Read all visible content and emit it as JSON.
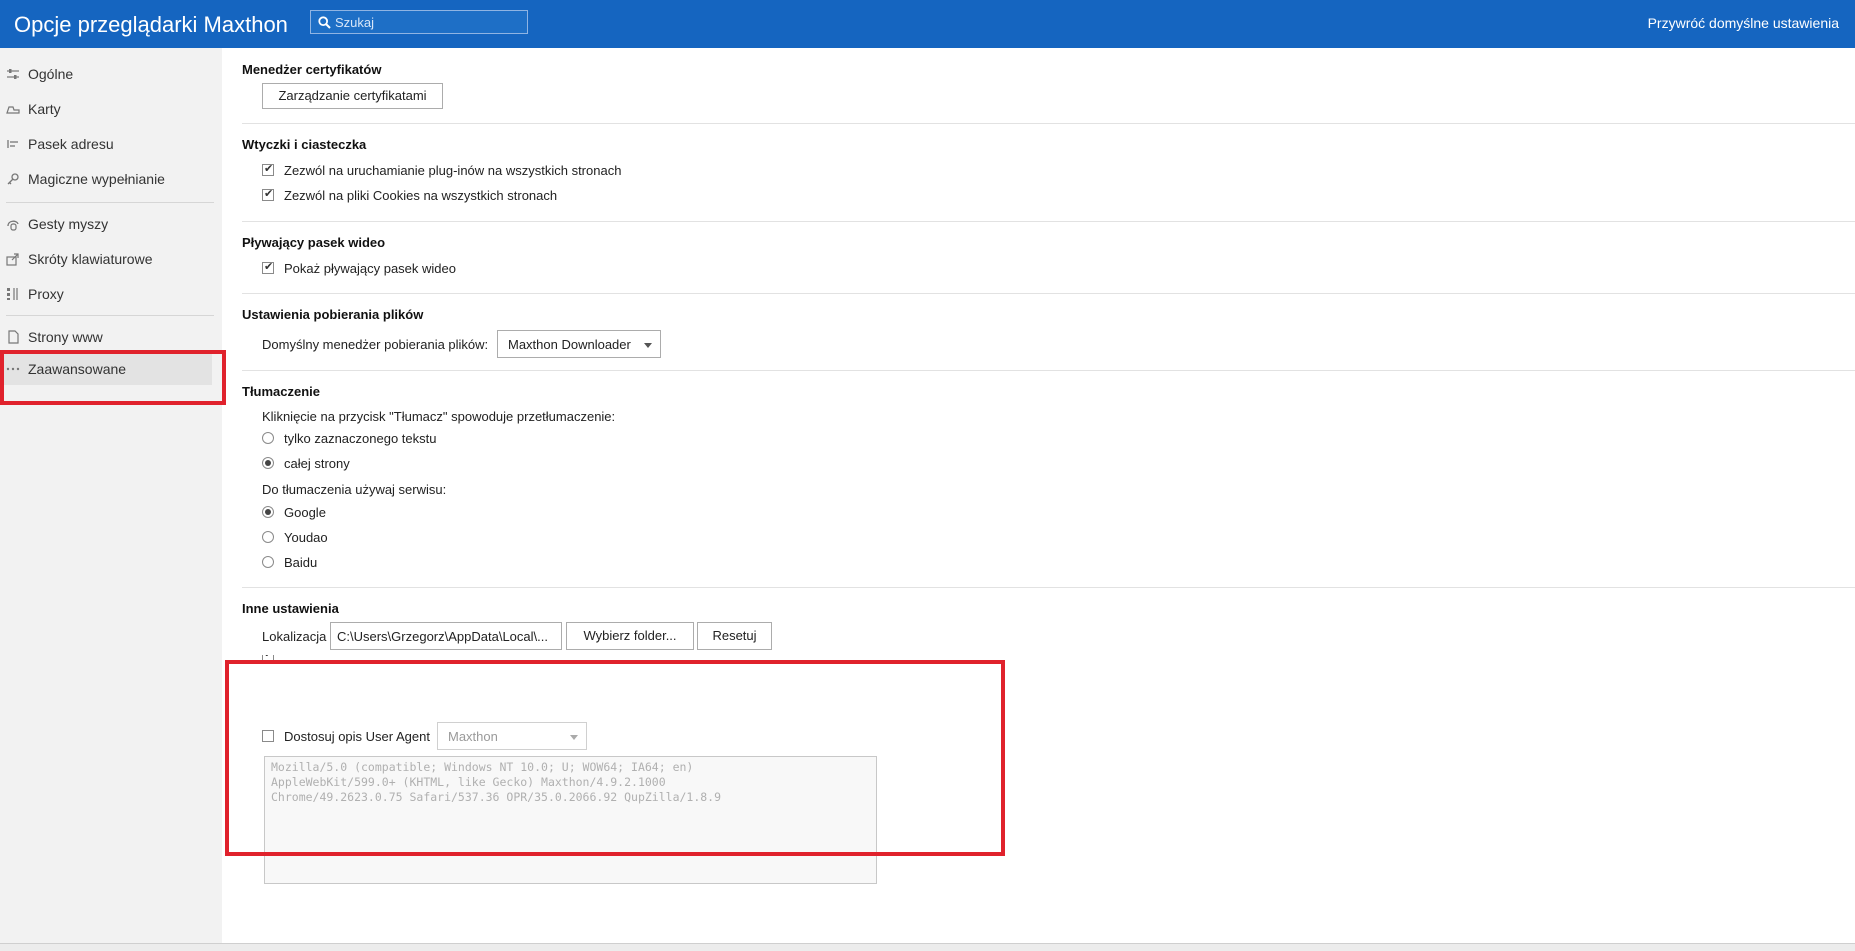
{
  "header": {
    "title": "Opcje przeglądarki Maxthon",
    "search_placeholder": "Szukaj",
    "reset_label": "Przywróć domyślne ustawienia"
  },
  "sidebar": {
    "items": [
      {
        "label": "Ogólne",
        "icon": "sliders-icon"
      },
      {
        "label": "Karty",
        "icon": "tabs-icon"
      },
      {
        "label": "Pasek adresu",
        "icon": "address-bar-icon"
      },
      {
        "label": "Magiczne wypełnianie",
        "icon": "key-icon"
      },
      {
        "label": "Gesty myszy",
        "icon": "mouse-gesture-icon"
      },
      {
        "label": "Skróty klawiaturowe",
        "icon": "shortcut-icon"
      },
      {
        "label": "Proxy",
        "icon": "proxy-icon"
      },
      {
        "label": "Strony www",
        "icon": "page-icon"
      },
      {
        "label": "Zaawansowane",
        "icon": "more-icon"
      }
    ],
    "active_index": 8
  },
  "sections": {
    "cert": {
      "title": "Menedżer certyfikatów",
      "button": "Zarządzanie certyfikatami"
    },
    "plugins": {
      "title": "Wtyczki i ciasteczka",
      "opt1": "Zezwól na uruchamianie plug-inów na wszystkich stronach",
      "opt2": "Zezwól na pliki Cookies na wszystkich stronach"
    },
    "video": {
      "title": "Pływający pasek wideo",
      "opt1": "Pokaż pływający pasek wideo"
    },
    "downloads": {
      "title": "Ustawienia pobierania plików",
      "label": "Domyślny menedżer pobierania plików:",
      "selected": "Maxthon Downloader"
    },
    "translate": {
      "title": "Tłumaczenie",
      "intro": "Kliknięcie na przycisk \"Tłumacz\" spowoduje przetłumaczenie:",
      "scope_opt1": "tylko zaznaczonego tekstu",
      "scope_opt2": "całej strony",
      "service_label": "Do tłumaczenia używaj serwisu:",
      "service_opt1": "Google",
      "service_opt2": "Youdao",
      "service_opt3": "Baidu"
    },
    "other": {
      "title": "Inne ustawienia",
      "location_label": "Lokalizacja",
      "location_value": "C:\\Users\\Grzegorz\\AppData\\Local\\...",
      "choose_folder": "Wybierz folder...",
      "reset": "Resetuj",
      "ua_label": "Dostosuj opis User Agent",
      "ua_selected": "Maxthon",
      "ua_text": "Mozilla/5.0 (compatible; Windows NT 10.0; U; WOW64; IA64; en)\nAppleWebKit/599.0+ (KHTML, like Gecko) Maxthon/4.9.2.1000\nChrome/49.2623.0.75 Safari/537.36 OPR/35.0.2066.92 QupZilla/1.8.9"
    }
  },
  "colors": {
    "header_bg": "#1565c0",
    "sidebar_bg": "#f2f2f2",
    "highlight": "#e0222c"
  }
}
